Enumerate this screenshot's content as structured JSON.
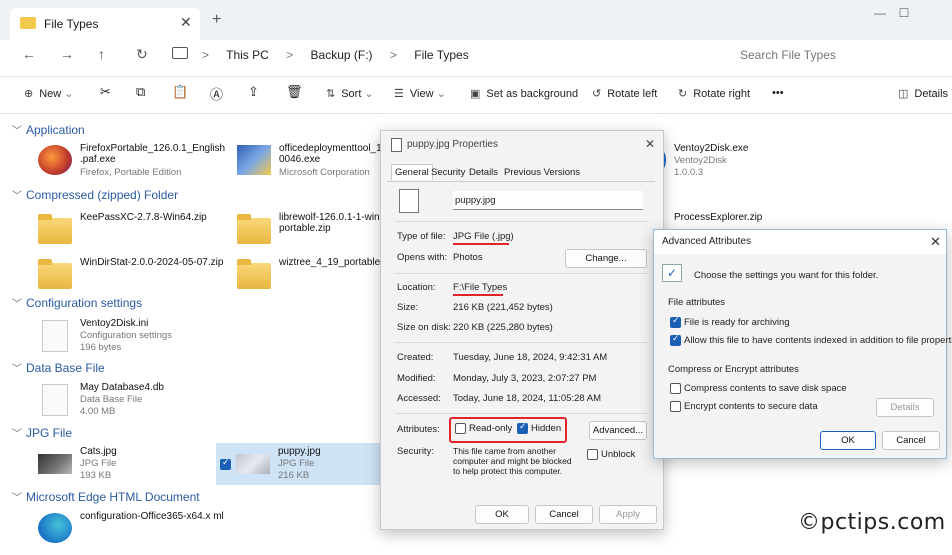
{
  "tab": {
    "title": "File Types",
    "close": "✕",
    "new": "+"
  },
  "window_controls": {
    "minimize": "—",
    "maximize": "☐",
    "close": "✕"
  },
  "nav": {
    "back": "←",
    "forward": "→",
    "up": "↑",
    "refresh": "↻",
    "pc_icon": "computer-icon"
  },
  "breadcrumbs": [
    "This PC",
    "Backup (F:)",
    "File Types"
  ],
  "breadcrumb_sep": ">",
  "search": {
    "placeholder": "Search File Types"
  },
  "toolbar": {
    "new": "New",
    "sort": "Sort",
    "view": "View",
    "set_bg": "Set as background",
    "rotate_left": "Rotate left",
    "rotate_right": "Rotate right",
    "more": "•••",
    "details": "Details"
  },
  "groups": {
    "application": "Application",
    "compressed": "Compressed (zipped) Folder",
    "config": "Configuration settings",
    "database": "Data Base File",
    "jpg": "JPG File",
    "edge": "Microsoft Edge HTML Document"
  },
  "files": {
    "firefox": {
      "name": "FirefoxPortable_126.0.1_English .paf.exe",
      "sub": "Firefox, Portable Edition"
    },
    "office": {
      "name": "officedeploymenttool_17 0046.exe",
      "sub": "Microsoft Corporation"
    },
    "ventoy_exe": {
      "name": "Ventoy2Disk.exe",
      "sub1": "Ventoy2Disk",
      "sub2": "1.0.0.3"
    },
    "keepass": {
      "name": "KeePassXC-2.7.8-Win64.zip"
    },
    "librewolf": {
      "name": "librewolf-126.0.1-1-windo 86_64-portable.zip"
    },
    "procexp": {
      "name": "ProcessExplorer.zip"
    },
    "windirstat": {
      "name": "WinDirStat-2.0.0-2024-05-07.zip"
    },
    "wiztree": {
      "name": "wiztree_4_19_portable.zip"
    },
    "ventoy_ini": {
      "name": "Ventoy2Disk.ini",
      "sub1": "Configuration settings",
      "sub2": "196 bytes"
    },
    "maydb": {
      "name": "May Database4.db",
      "sub1": "Data Base File",
      "sub2": "4.00 MB"
    },
    "cats": {
      "name": "Cats.jpg",
      "sub1": "JPG File",
      "sub2": "193 KB"
    },
    "puppy": {
      "name": "puppy.jpg",
      "sub1": "JPG File",
      "sub2": "216 KB"
    },
    "config_edge": {
      "name": "configuration-Office365-x64.x ml"
    }
  },
  "props": {
    "title": "puppy.jpg Properties",
    "close": "✕",
    "tabs": [
      "General",
      "Security",
      "Details",
      "Previous Versions"
    ],
    "filename": "puppy.jpg",
    "type_label": "Type of file:",
    "type_value": "JPG File (.jpg)",
    "opens_label": "Opens with:",
    "opens_value": "Photos",
    "change": "Change...",
    "location_label": "Location:",
    "location_value": "F:\\File Types",
    "size_label": "Size:",
    "size_value": "216 KB (221,452 bytes)",
    "disk_label": "Size on disk:",
    "disk_value": "220 KB (225,280 bytes)",
    "created_label": "Created:",
    "created_value": "Tuesday, June 18, 2024, 9:42:31 AM",
    "modified_label": "Modified:",
    "modified_value": "Monday, July 3, 2023, 2:07:27 PM",
    "accessed_label": "Accessed:",
    "accessed_value": "Today, June 18, 2024, 11:05:28 AM",
    "attributes_label": "Attributes:",
    "readonly": "Read-only",
    "hidden": "Hidden",
    "advanced": "Advanced...",
    "security_label": "Security:",
    "security_text": "This file came from another computer and might be blocked to help protect this computer.",
    "unblock": "Unblock",
    "ok": "OK",
    "cancel": "Cancel",
    "apply": "Apply"
  },
  "adv": {
    "title": "Advanced Attributes",
    "close": "✕",
    "intro": "Choose the settings you want for this folder.",
    "file_attrs": "File attributes",
    "archiving": "File is ready for archiving",
    "indexed": "Allow this file to have contents indexed in addition to file properties",
    "compress_group": "Compress or Encrypt attributes",
    "compress": "Compress contents to save disk space",
    "encrypt": "Encrypt contents to secure data",
    "details": "Details",
    "ok": "OK",
    "cancel": "Cancel"
  },
  "watermark": "©pctips.com",
  "colors": {
    "accent": "#1a5fb4",
    "highlight": "#e0242a",
    "group_header": "#2b5aa3"
  }
}
